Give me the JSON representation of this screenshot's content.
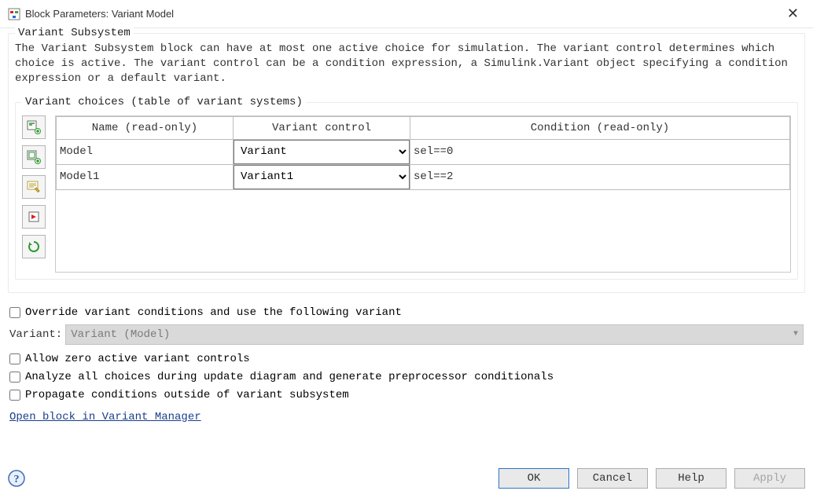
{
  "titlebar": {
    "title": "Block Parameters: Variant Model"
  },
  "section1": {
    "legend": "Variant Subsystem",
    "description": "The Variant Subsystem block can have at most one active choice for simulation. The variant control determines which choice is active. The variant control can be a condition expression, a Simulink.Variant object specifying a condition expression or a default variant."
  },
  "choices": {
    "legend": "Variant choices (table of variant systems)",
    "headers": {
      "name": "Name (read-only)",
      "control": "Variant control",
      "condition": "Condition (read-only)"
    },
    "rows": [
      {
        "name": "Model",
        "control": "Variant",
        "condition": "sel==0"
      },
      {
        "name": "Model1",
        "control": "Variant1",
        "condition": "sel==2"
      }
    ],
    "tool_icons": {
      "add_subsystem": "add-subsystem-icon",
      "add_modelref": "add-modelref-icon",
      "edit": "edit-icon",
      "open": "open-block-icon",
      "refresh": "refresh-icon"
    }
  },
  "options": {
    "override_label": "Override variant conditions and use the following variant",
    "variant_label": "Variant:",
    "variant_value": "Variant (Model)",
    "allow_zero": "Allow zero active variant controls",
    "analyze_all": "Analyze all choices during update diagram and generate preprocessor conditionals",
    "propagate": "Propagate conditions outside of variant subsystem",
    "link_text": "Open block in Variant Manager"
  },
  "buttons": {
    "ok": "OK",
    "cancel": "Cancel",
    "help": "Help",
    "apply": "Apply"
  }
}
